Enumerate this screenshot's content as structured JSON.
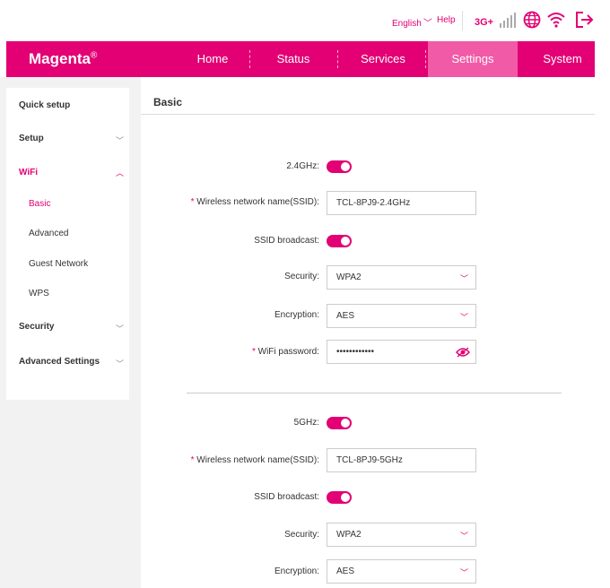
{
  "topbar": {
    "language": "English",
    "help": "Help",
    "network": "3G+"
  },
  "nav": {
    "brand": "Magenta",
    "brand_mark": "®",
    "items": [
      "Home",
      "Status",
      "Services",
      "Settings",
      "System"
    ],
    "active": "Settings"
  },
  "sidebar": {
    "quick_setup": "Quick setup",
    "setup": "Setup",
    "wifi": "WiFi",
    "wifi_sub": [
      "Basic",
      "Advanced",
      "Guest Network",
      "WPS"
    ],
    "security": "Security",
    "advanced_settings": "Advanced Settings"
  },
  "content": {
    "title": "Basic",
    "band24": {
      "label": "2.4GHz:",
      "enabled": true,
      "ssid_label": "Wireless network name(SSID):",
      "ssid_value": "TCL-8PJ9-2.4GHz",
      "broadcast_label": "SSID broadcast:",
      "broadcast_enabled": true,
      "security_label": "Security:",
      "security_value": "WPA2",
      "encryption_label": "Encryption:",
      "encryption_value": "AES",
      "password_label": "WiFi password:",
      "password_value": "••••••••••••"
    },
    "band5": {
      "label": "5GHz:",
      "enabled": true,
      "ssid_label": "Wireless network name(SSID):",
      "ssid_value": "TCL-8PJ9-5GHz",
      "broadcast_label": "SSID broadcast:",
      "broadcast_enabled": true,
      "security_label": "Security:",
      "security_value": "WPA2",
      "encryption_label": "Encryption:",
      "encryption_value": "AES"
    }
  },
  "colors": {
    "brand": "#e20074",
    "nav_active": "#f15aa6"
  }
}
